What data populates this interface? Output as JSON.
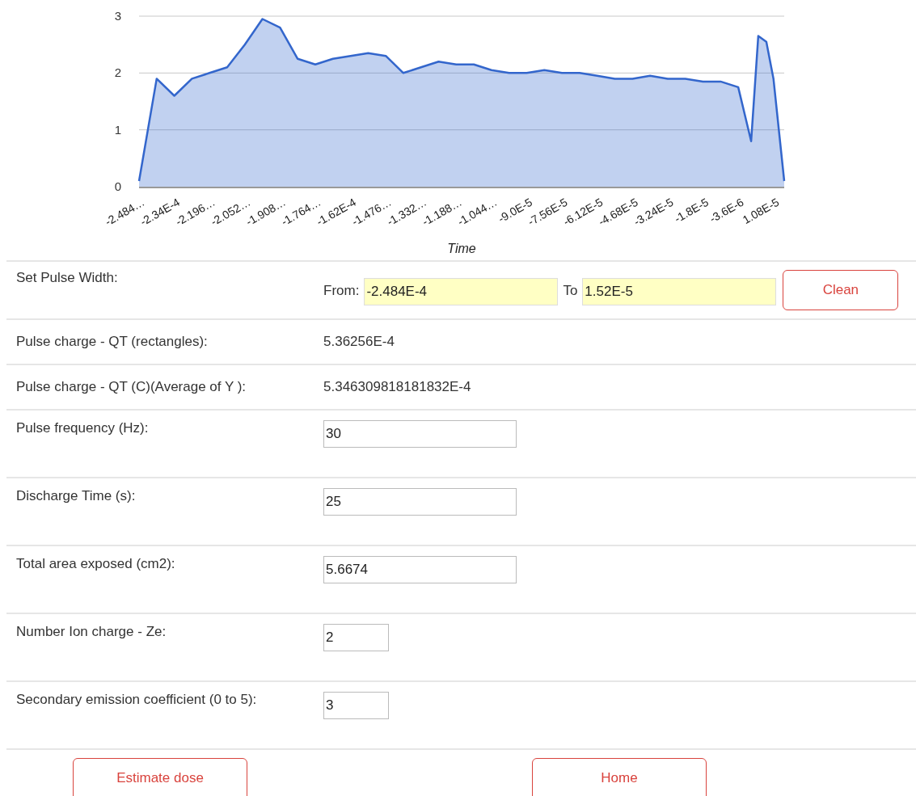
{
  "chart": {
    "chart_data": {
      "type": "area",
      "xlabel": "Time",
      "x": [
        -0.0002484,
        -0.0002412,
        -0.000234,
        -0.0002268,
        -0.0002196,
        -0.0002124,
        -0.0002052,
        -0.000198,
        -0.0001908,
        -0.0001836,
        -0.0001764,
        -0.0001692,
        -0.000162,
        -0.0001548,
        -0.0001476,
        -0.0001404,
        -0.0001332,
        -0.000126,
        -0.0001188,
        -0.0001116,
        -0.0001044,
        -9.72e-05,
        -9e-05,
        -8.28e-05,
        -7.56e-05,
        -6.84e-05,
        -6.12e-05,
        -5.4e-05,
        -4.68e-05,
        -3.96e-05,
        -3.24e-05,
        -2.52e-05,
        -1.8e-05,
        -1.08e-05,
        -3.6e-06,
        1.7e-06,
        4.6e-06,
        7.9e-06,
        1.08e-05,
        1.52e-05
      ],
      "series": [
        {
          "color": "#3366cc",
          "values": [
            0.1,
            1.9,
            1.6,
            1.9,
            2.0,
            2.1,
            2.5,
            2.95,
            2.8,
            2.25,
            2.15,
            2.25,
            2.3,
            2.35,
            2.3,
            2.0,
            2.1,
            2.2,
            2.15,
            2.15,
            2.05,
            2.0,
            2.0,
            2.05,
            2.0,
            2.0,
            1.95,
            1.9,
            1.9,
            1.95,
            1.9,
            1.9,
            1.85,
            1.85,
            1.75,
            0.8,
            2.65,
            2.55,
            1.9,
            0.1
          ]
        }
      ],
      "xlim": [
        -0.0002484,
        1.52e-05
      ],
      "ylim": [
        0,
        3
      ],
      "yticks": [
        0,
        1,
        2,
        3
      ],
      "xticks": [
        {
          "value": -0.0002484,
          "label": "-2.484…"
        },
        {
          "value": -0.000234,
          "label": "-2.34E-4"
        },
        {
          "value": -0.0002196,
          "label": "-2.196…"
        },
        {
          "value": -0.0002052,
          "label": "-2.052…"
        },
        {
          "value": -0.0001908,
          "label": "-1.908…"
        },
        {
          "value": -0.0001764,
          "label": "-1.764…"
        },
        {
          "value": -0.000162,
          "label": "-1.62E-4"
        },
        {
          "value": -0.0001476,
          "label": "-1.476…"
        },
        {
          "value": -0.0001332,
          "label": "-1.332…"
        },
        {
          "value": -0.0001188,
          "label": "-1.188…"
        },
        {
          "value": -0.0001044,
          "label": "-1.044…"
        },
        {
          "value": -9e-05,
          "label": "-9.0E-5"
        },
        {
          "value": -7.56e-05,
          "label": "-7.56E-5"
        },
        {
          "value": -6.12e-05,
          "label": "-6.12E-5"
        },
        {
          "value": -4.68e-05,
          "label": "-4.68E-5"
        },
        {
          "value": -3.24e-05,
          "label": "-3.24E-5"
        },
        {
          "value": -1.8e-05,
          "label": "-1.8E-5"
        },
        {
          "value": -3.6e-06,
          "label": "-3.6E-6"
        },
        {
          "value": 1.08e-05,
          "label": "1.08E-5"
        }
      ]
    }
  },
  "pulse_width": {
    "label": "Set Pulse Width:",
    "from_label": "From:",
    "from_value": "-2.484E-4",
    "to_label": "To",
    "to_value": "1.52E-5",
    "clean_button": "Clean"
  },
  "readouts": [
    {
      "label": "Pulse charge - QT (rectangles):",
      "value": "5.36256E-4"
    },
    {
      "label": "Pulse charge - QT (C)(Average of Y ):",
      "value": "5.346309818181832E-4"
    }
  ],
  "inputs": [
    {
      "label": "Pulse frequency (Hz):",
      "value": "30",
      "kind": "wide"
    },
    {
      "label": "Discharge Time (s):",
      "value": "25",
      "kind": "wide"
    },
    {
      "label": "Total area exposed (cm2):",
      "value": "5.6674",
      "kind": "wide"
    },
    {
      "label": "Number Ion charge - Ze:",
      "value": "2",
      "kind": "short"
    },
    {
      "label": "Secondary emission coefficient (0 to 5):",
      "value": "3",
      "kind": "short"
    }
  ],
  "buttons": [
    "Estimate dose",
    "Home"
  ]
}
